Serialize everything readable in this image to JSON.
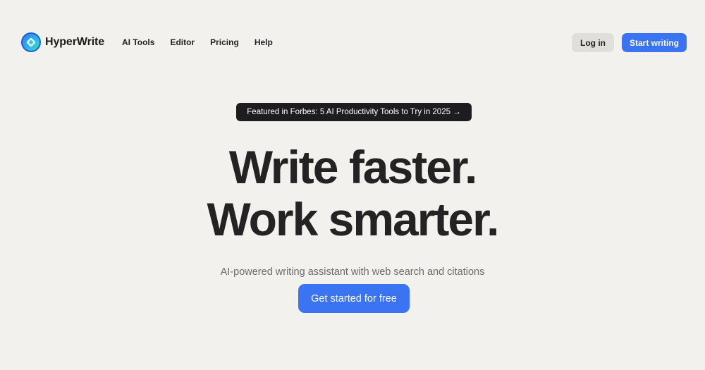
{
  "header": {
    "brand_name": "HyperWrite",
    "logo_icon": "hyperwrite-logo-icon",
    "nav": [
      {
        "label": "AI Tools"
      },
      {
        "label": "Editor"
      },
      {
        "label": "Pricing"
      },
      {
        "label": "Help"
      }
    ],
    "login_label": "Log in",
    "start_label": "Start writing"
  },
  "hero": {
    "badge": "Featured in Forbes: 5 AI Productivity Tools to Try in 2025 →",
    "headline_line1": "Write faster.",
    "headline_line2": "Work smarter.",
    "subtitle": "AI-powered writing assistant with web search and citations",
    "cta_label": "Get started for free"
  },
  "colors": {
    "background": "#f2f1ee",
    "accent": "#3b74f2",
    "badge_bg": "#1d1d1f",
    "secondary_button": "#e0dfdc"
  }
}
